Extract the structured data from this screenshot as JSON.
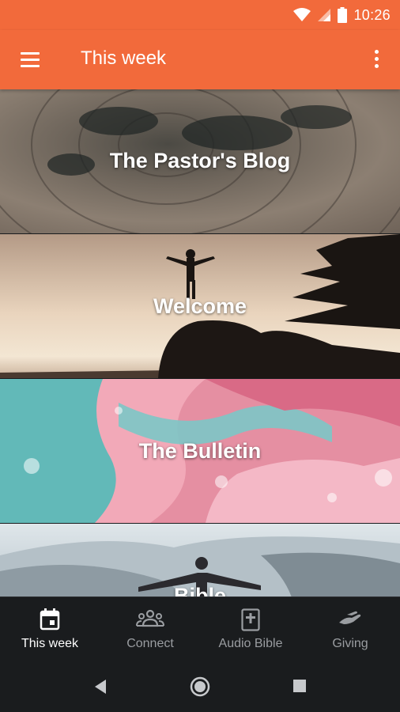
{
  "status_bar": {
    "time": "10:26"
  },
  "app_bar": {
    "title": "This week"
  },
  "cards": [
    {
      "label": "The Pastor's Blog"
    },
    {
      "label": "Welcome"
    },
    {
      "label": "The Bulletin"
    },
    {
      "label": "Bible"
    }
  ],
  "bottom_nav": {
    "items": [
      {
        "label": "This week",
        "icon": "calendar-icon",
        "active": true
      },
      {
        "label": "Connect",
        "icon": "group-icon",
        "active": false
      },
      {
        "label": "Audio Bible",
        "icon": "bible-icon",
        "active": false
      },
      {
        "label": "Giving",
        "icon": "giving-hand-icon",
        "active": false
      }
    ]
  },
  "colors": {
    "primary": "#f26a3b",
    "nav_background": "#1a1c1e",
    "nav_active": "#ffffff",
    "nav_inactive": "#9a9da1"
  }
}
